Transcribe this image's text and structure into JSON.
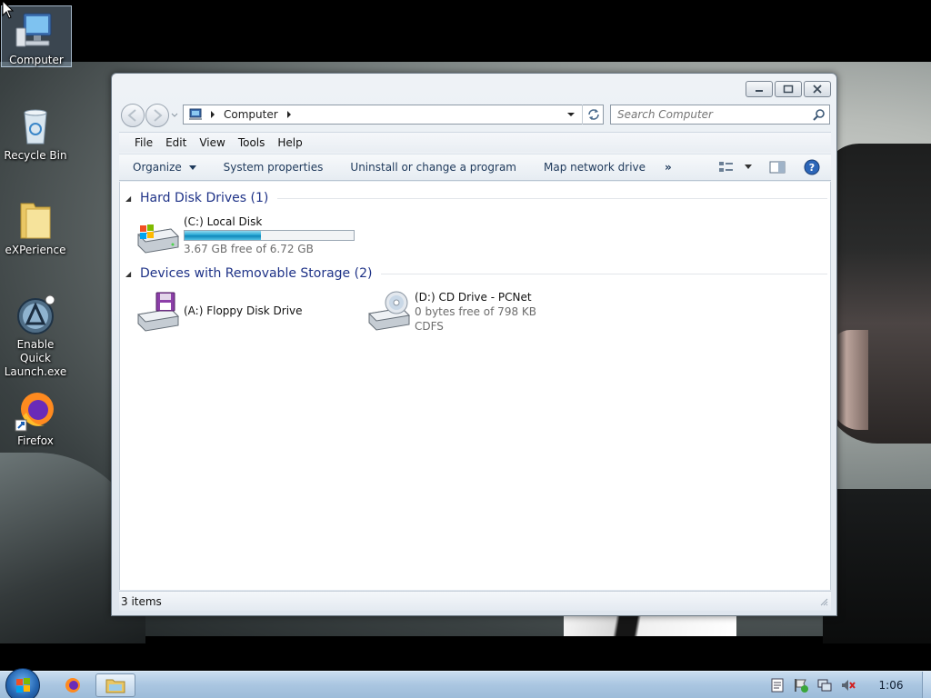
{
  "desktop": {
    "icons": [
      {
        "label": "Computer"
      },
      {
        "label": "Recycle Bin"
      },
      {
        "label": "eXPerience"
      },
      {
        "label": "Enable Quick Launch.exe"
      },
      {
        "label": "Firefox"
      }
    ]
  },
  "window": {
    "address": {
      "crumb": "Computer"
    },
    "search": {
      "placeholder": "Search Computer"
    },
    "menu": [
      "File",
      "Edit",
      "View",
      "Tools",
      "Help"
    ],
    "commands": {
      "organize": "Organize",
      "system_properties": "System properties",
      "uninstall": "Uninstall or change a program",
      "map_drive": "Map network drive",
      "more": "»"
    },
    "groups": [
      {
        "title": "Hard Disk Drives (1)",
        "items": [
          {
            "name": "(C:) Local Disk",
            "free": "3.67 GB free of 6.72 GB",
            "used_fraction": 0.454
          }
        ]
      },
      {
        "title": "Devices with Removable Storage (2)",
        "items": [
          {
            "name": "(A:) Floppy Disk Drive"
          },
          {
            "name": "(D:) CD Drive - PCNet",
            "free": "0 bytes free of 798 KB",
            "fs": "CDFS"
          }
        ]
      }
    ],
    "status": "3 items"
  },
  "taskbar": {
    "clock": "1:06"
  },
  "colors": {
    "group_header": "#1e3287",
    "command_text": "#1e395b",
    "progress_fill": "#2aa9d6"
  }
}
